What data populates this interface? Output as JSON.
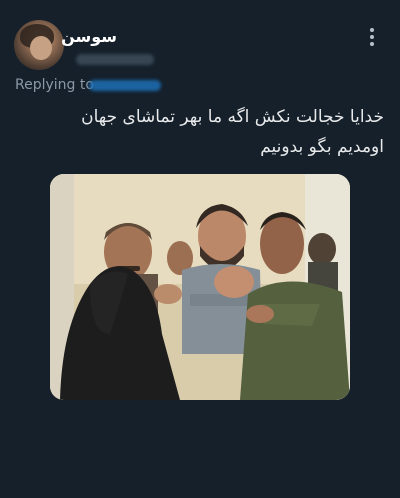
{
  "tweet": {
    "author_name": "سوسن",
    "replying_label": "Replying to",
    "text_line1": "خدایا خجالت نکش اگه ما بهر تماشای جهان",
    "text_line2": "اومدیم بگو بدونیم"
  },
  "icons": {
    "more": "more-vertical-icon"
  },
  "colors": {
    "background": "#15202b",
    "text": "#e7e9ea",
    "muted": "#8b98a5",
    "link": "#1d9bf0"
  }
}
